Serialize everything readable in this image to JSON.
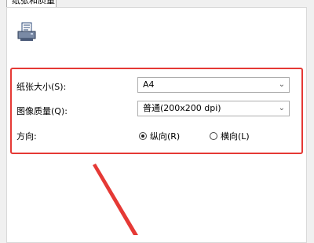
{
  "dialog": {
    "tab_label": "纸张和质量"
  },
  "settings": {
    "paper_size_label": "纸张大小(S):",
    "paper_size_value": "A4",
    "image_quality_label": "图像质量(Q):",
    "image_quality_value": "普通(200x200 dpi)",
    "orientation_label": "方向:",
    "orientation_portrait": "纵向(R)",
    "orientation_landscape": "横向(L)",
    "orientation_selected": "portrait"
  },
  "colors": {
    "highlight": "#e53935"
  },
  "icons": {
    "printer": "printer-icon",
    "dropdown": "chevron-down-icon"
  }
}
